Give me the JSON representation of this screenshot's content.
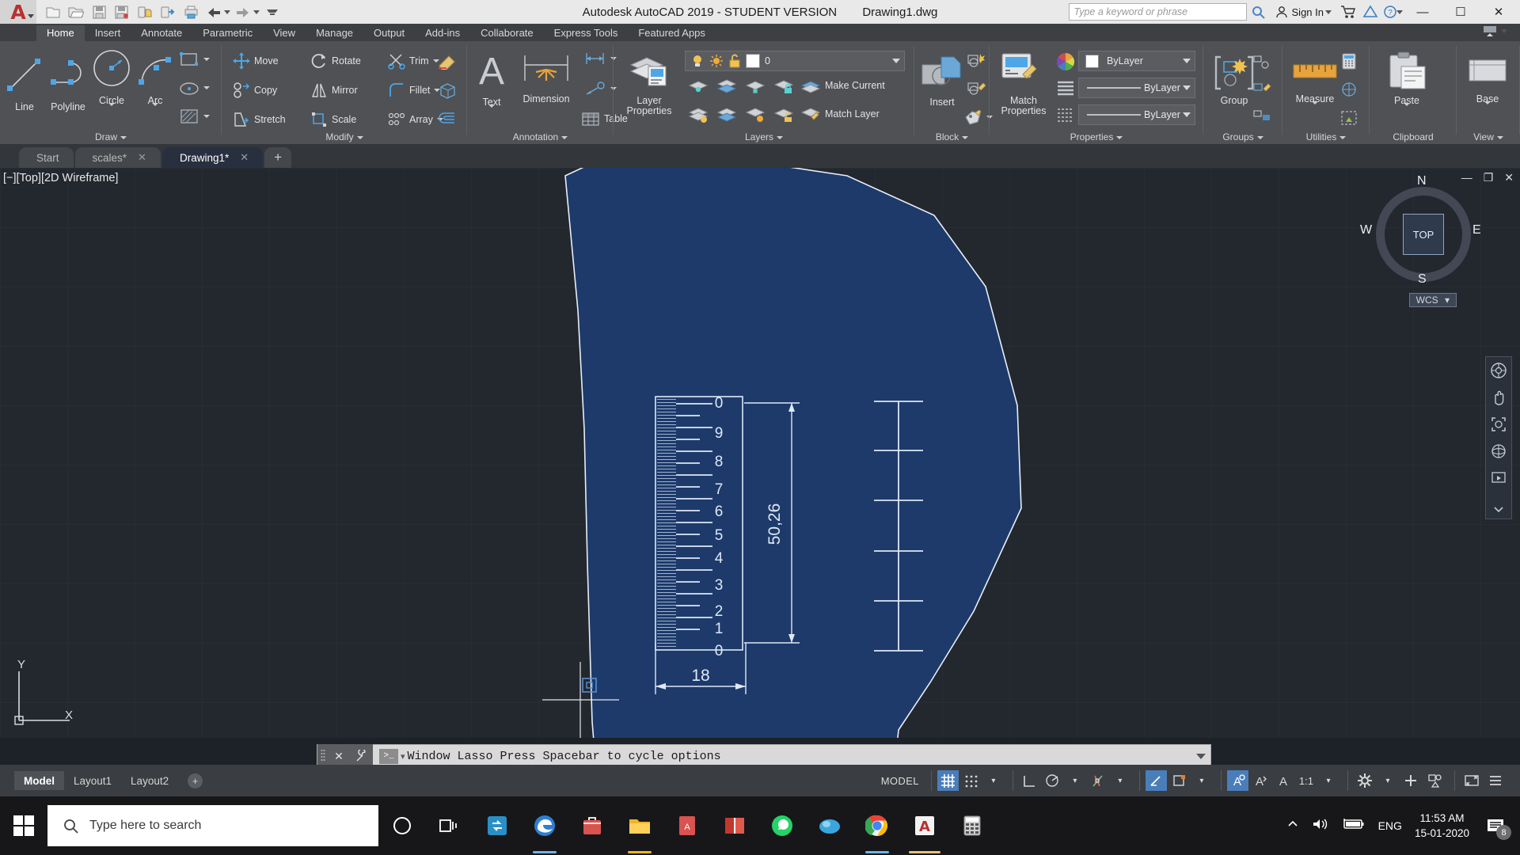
{
  "titlebar": {
    "app_title": "Autodesk AutoCAD 2019 - STUDENT VERSION",
    "document_title": "Drawing1.dwg",
    "quick_access": [
      {
        "name": "new-file-icon",
        "label": "New"
      },
      {
        "name": "open-file-icon",
        "label": "Open"
      },
      {
        "name": "save-icon",
        "label": "Save"
      },
      {
        "name": "save-as-icon",
        "label": "Save As"
      },
      {
        "name": "plot-preview-icon",
        "label": "Plot Preview"
      },
      {
        "name": "publish-icon",
        "label": "Publish"
      },
      {
        "name": "print-icon",
        "label": "Plot"
      },
      {
        "name": "undo-icon",
        "label": "Undo"
      },
      {
        "name": "redo-icon",
        "label": "Redo"
      },
      {
        "name": "customize-qat-icon",
        "label": "Customize"
      }
    ],
    "search_placeholder": "Type a keyword or phrase",
    "sign_in": "Sign In",
    "help_label": "?",
    "window_buttons": {
      "minimize": "—",
      "maximize": "☐",
      "close": "✕"
    }
  },
  "ribbon_tabs": [
    {
      "label": "Home",
      "active": true
    },
    {
      "label": "Insert",
      "active": false
    },
    {
      "label": "Annotate",
      "active": false
    },
    {
      "label": "Parametric",
      "active": false
    },
    {
      "label": "View",
      "active": false
    },
    {
      "label": "Manage",
      "active": false
    },
    {
      "label": "Output",
      "active": false
    },
    {
      "label": "Add-ins",
      "active": false
    },
    {
      "label": "Collaborate",
      "active": false
    },
    {
      "label": "Express Tools",
      "active": false
    },
    {
      "label": "Featured Apps",
      "active": false
    }
  ],
  "panels": {
    "draw": {
      "label": "Draw",
      "big": [
        {
          "name": "line-tool",
          "label": "Line"
        },
        {
          "name": "polyline-tool",
          "label": "Polyline"
        },
        {
          "name": "circle-tool",
          "label": "Circle"
        },
        {
          "name": "arc-tool",
          "label": "Arc"
        }
      ],
      "flyouts": [
        {
          "name": "rectangle-tool",
          "label": "Rectangle"
        },
        {
          "name": "ellipse-tool",
          "label": "Ellipse"
        },
        {
          "name": "hatch-tool",
          "label": "Hatch"
        }
      ]
    },
    "modify": {
      "label": "Modify",
      "items": [
        {
          "name": "move-tool",
          "label": "Move"
        },
        {
          "name": "rotate-tool",
          "label": "Rotate"
        },
        {
          "name": "trim-tool",
          "label": "Trim"
        },
        {
          "name": "copy-tool",
          "label": "Copy"
        },
        {
          "name": "mirror-tool",
          "label": "Mirror"
        },
        {
          "name": "fillet-tool",
          "label": "Fillet"
        },
        {
          "name": "stretch-tool",
          "label": "Stretch"
        },
        {
          "name": "scale-tool",
          "label": "Scale"
        },
        {
          "name": "array-tool",
          "label": "Array"
        }
      ]
    },
    "annotation": {
      "label": "Annotation",
      "big": [
        {
          "name": "text-tool",
          "label": "Text"
        },
        {
          "name": "dimension-tool",
          "label": "Dimension"
        }
      ],
      "items": [
        {
          "name": "linear-dimension-tool",
          "label": ""
        },
        {
          "name": "leader-tool",
          "label": ""
        },
        {
          "name": "table-tool",
          "label": "Table"
        }
      ]
    },
    "layers": {
      "label": "Layers",
      "big": {
        "name": "layer-properties-tool",
        "label_1": "Layer",
        "label_2": "Properties"
      },
      "current_layer": "0",
      "items": [
        {
          "name": "make-current-button",
          "label": "Make Current"
        },
        {
          "name": "match-layer-button",
          "label": "Match Layer"
        }
      ]
    },
    "block": {
      "label": "Block",
      "big": {
        "name": "insert-block-tool",
        "label": "Insert"
      }
    },
    "properties": {
      "label": "Properties",
      "big": {
        "name": "match-properties-tool",
        "label_1": "Match",
        "label_2": "Properties"
      },
      "color": "ByLayer",
      "linetype": "ByLayer",
      "lineweight": "ByLayer"
    },
    "groups": {
      "label": "Groups",
      "big": {
        "name": "group-tool",
        "label": "Group"
      }
    },
    "utilities": {
      "label": "Utilities",
      "big": {
        "name": "measure-tool",
        "label": "Measure"
      }
    },
    "clipboard": {
      "label": "Clipboard",
      "big": {
        "name": "paste-tool",
        "label": "Paste"
      }
    },
    "view": {
      "label": "View",
      "big": {
        "name": "base-view-tool",
        "label": "Base"
      }
    }
  },
  "file_tabs": [
    {
      "label": "Start",
      "closable": false,
      "active": false
    },
    {
      "label": "scales*",
      "closable": true,
      "active": false
    },
    {
      "label": "Drawing1*",
      "closable": true,
      "active": true
    }
  ],
  "new_tab_label": "+",
  "viewport": {
    "label": "[−][Top][2D Wireframe]",
    "controls": {
      "minimize": "—",
      "maximize": "❐",
      "close": "✕"
    },
    "background_color": "#23282f",
    "shape_fill": "#1d3a6b",
    "line_color": "#dfe6f0"
  },
  "viewcube": {
    "face": "TOP",
    "north": "N",
    "south": "S",
    "east": "E",
    "west": "W",
    "ucs_label": "WCS"
  },
  "drawing": {
    "ruler_numbers": [
      "0",
      "9",
      "8",
      "7",
      "6",
      "5",
      "4",
      "3",
      "2",
      "1",
      "0"
    ],
    "vertical_dimension": "50,26",
    "horizontal_dimension": "18"
  },
  "ucs_icon": {
    "x_label": "X",
    "y_label": "Y"
  },
  "command_line": {
    "prompt_glyph": ">_",
    "text": "Window Lasso  Press Spacebar to cycle options",
    "close_glyph": "✕",
    "settings_glyph": "⚒"
  },
  "layout_tabs": [
    {
      "label": "Model",
      "active": true
    },
    {
      "label": "Layout1",
      "active": false
    },
    {
      "label": "Layout2",
      "active": false
    }
  ],
  "layout_add": "+",
  "status_bar": {
    "space": "MODEL",
    "scale": "1:1",
    "items": [
      {
        "name": "grid-display-toggle",
        "on": true
      },
      {
        "name": "snap-mode-toggle",
        "on": false
      },
      {
        "name": "ortho-mode-toggle",
        "on": false
      },
      {
        "name": "polar-tracking-toggle",
        "on": false
      },
      {
        "name": "object-snap-toggle",
        "on": false
      },
      {
        "name": "isometric-drafting-toggle",
        "on": false
      },
      {
        "name": "object-snap-tracking-toggle",
        "on": true
      },
      {
        "name": "dynamic-ucs-toggle",
        "on": false
      },
      {
        "name": "annotation-visibility-toggle",
        "on": false
      },
      {
        "name": "customization-button",
        "on": false
      },
      {
        "name": "isolate-objects-button",
        "on": false
      },
      {
        "name": "clean-screen-button",
        "on": false
      }
    ]
  },
  "taskbar": {
    "search_placeholder": "Type here to search",
    "language": "ENG",
    "time": "11:53 AM",
    "date": "15-01-2020",
    "notification_count": "8",
    "apps": [
      {
        "name": "cortana-icon",
        "color": "#ffffff"
      },
      {
        "name": "task-view-icon",
        "color": "#ffffff"
      },
      {
        "name": "store-sync-icon",
        "color": "#36a9e1"
      },
      {
        "name": "edge-icon",
        "color": "#2f7fd0"
      },
      {
        "name": "microsoft-store-icon",
        "color": "#d9534f"
      },
      {
        "name": "file-explorer-icon",
        "color": "#f0b429"
      },
      {
        "name": "pdf-reader-icon",
        "color": "#d9534f"
      },
      {
        "name": "book-reader-icon",
        "color": "#c0392b"
      },
      {
        "name": "whatsapp-icon",
        "color": "#25d366"
      },
      {
        "name": "media-player-icon",
        "color": "#3aa6dd"
      },
      {
        "name": "chrome-icon",
        "color": "#4285f4"
      },
      {
        "name": "autocad-icon",
        "color": "#b8312f"
      },
      {
        "name": "calculator-icon",
        "color": "#cccccc"
      }
    ]
  }
}
